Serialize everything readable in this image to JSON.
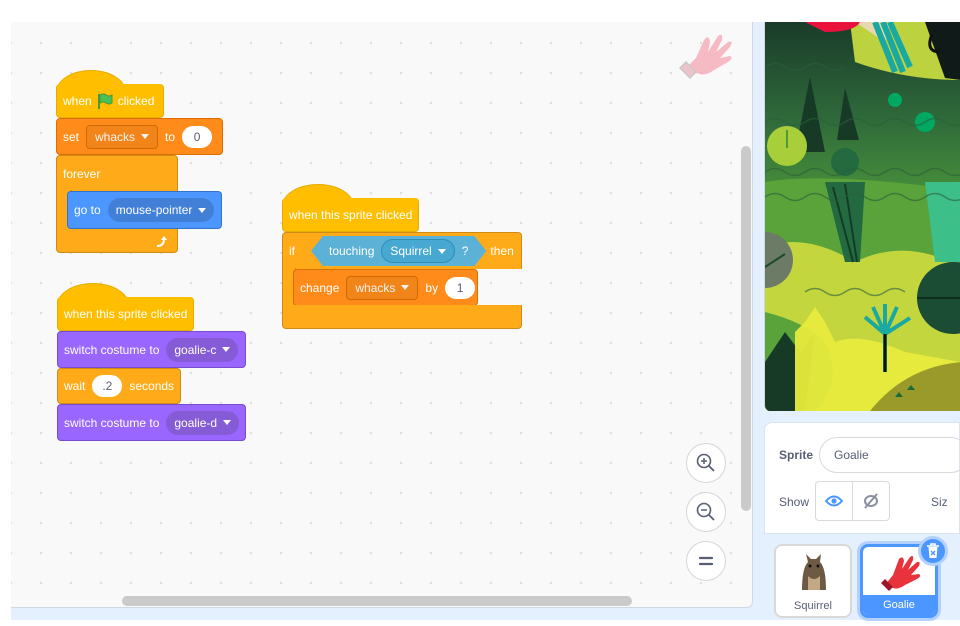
{
  "scripts": {
    "green_flag_script": {
      "hat": {
        "when": "when",
        "clicked": "clicked"
      },
      "set_block": {
        "label": "set",
        "variable": "whacks",
        "to": "to",
        "value": "0"
      },
      "forever_block": {
        "label": "forever"
      },
      "goto_block": {
        "label": "go to",
        "target": "mouse-pointer"
      }
    },
    "sprite_clicked_if_script": {
      "hat": {
        "label": "when this sprite clicked"
      },
      "if_block": {
        "if": "if",
        "then": "then"
      },
      "touching_block": {
        "label": "touching",
        "target": "Squirrel",
        "question": "?"
      },
      "change_block": {
        "label": "change",
        "variable": "whacks",
        "by": "by",
        "value": "1"
      }
    },
    "sprite_clicked_costume_script": {
      "hat": {
        "label": "when this sprite clicked"
      },
      "switch1": {
        "label": "switch costume to",
        "costume": "goalie-c"
      },
      "wait": {
        "label": "wait",
        "value": ".2",
        "unit": "seconds"
      },
      "switch2": {
        "label": "switch costume to",
        "costume": "goalie-d"
      }
    }
  },
  "colors": {
    "events": "#ffbf00",
    "variables": "#ff8c1a",
    "control": "#ffab19",
    "motion": "#4c97ff",
    "looks": "#9966ff",
    "sensing": "#5cb1d6",
    "accent": "#4c97ff"
  },
  "sprite_info": {
    "sprite_label": "Sprite",
    "sprite_name": "Goalie",
    "show_label": "Show",
    "size_label": "Siz"
  },
  "sprites": [
    {
      "name": "Squirrel",
      "selected": false
    },
    {
      "name": "Goalie",
      "selected": true
    }
  ],
  "icons": {
    "zoom_in": "zoom-in-icon",
    "zoom_out": "zoom-out-icon",
    "zoom_reset": "equals-icon",
    "show": "eye-icon",
    "hide": "eye-slash-icon",
    "delete": "trash-icon"
  }
}
